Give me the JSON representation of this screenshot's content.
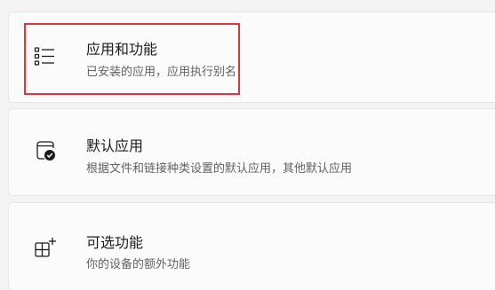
{
  "settings": {
    "items": [
      {
        "title": "应用和功能",
        "description": "已安装的应用，应用执行别名",
        "icon": "apps-list-icon"
      },
      {
        "title": "默认应用",
        "description": "根据文件和链接种类设置的默认应用，其他默认应用",
        "icon": "default-apps-icon"
      },
      {
        "title": "可选功能",
        "description": "你的设备的额外功能",
        "icon": "optional-features-icon"
      }
    ]
  },
  "annotation": {
    "highlight_color": "#e0353b"
  }
}
